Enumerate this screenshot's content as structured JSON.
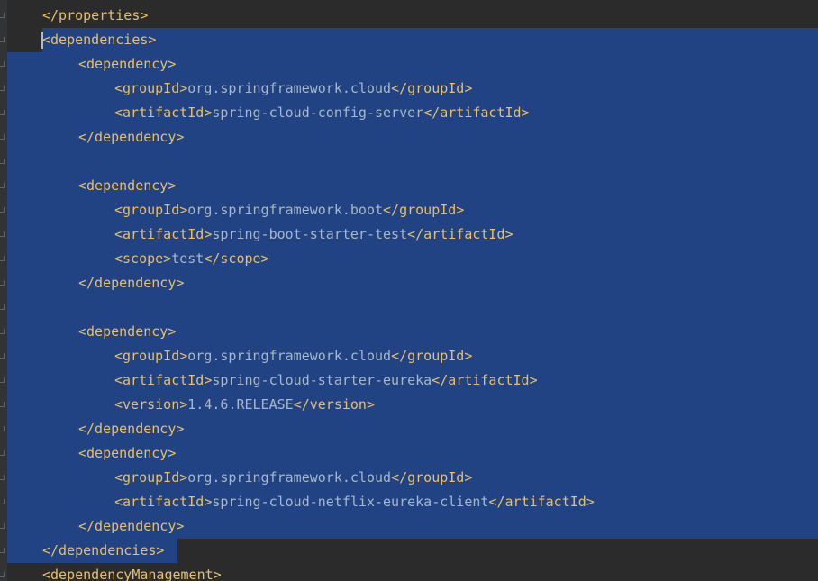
{
  "editor": {
    "language": "xml",
    "colors": {
      "background": "#2b2b2b",
      "gutter": "#313335",
      "selection": "#214283",
      "tag": "#e8bf6a",
      "text": "#a9b7c6"
    },
    "lines": [
      {
        "indent": 1,
        "parts": [
          {
            "t": "tag",
            "v": "</properties>"
          }
        ]
      },
      {
        "indent": 1,
        "parts": [
          {
            "t": "tag",
            "v": "<dependencies>"
          }
        ]
      },
      {
        "indent": 2,
        "parts": [
          {
            "t": "tag",
            "v": "<dependency>"
          }
        ]
      },
      {
        "indent": 3,
        "parts": [
          {
            "t": "tag",
            "v": "<groupId>"
          },
          {
            "t": "txt",
            "v": "org.springframework.cloud"
          },
          {
            "t": "tag",
            "v": "</groupId>"
          }
        ]
      },
      {
        "indent": 3,
        "parts": [
          {
            "t": "tag",
            "v": "<artifactId>"
          },
          {
            "t": "txt",
            "v": "spring-cloud-config-server"
          },
          {
            "t": "tag",
            "v": "</artifactId>"
          }
        ]
      },
      {
        "indent": 2,
        "parts": [
          {
            "t": "tag",
            "v": "</dependency>"
          }
        ]
      },
      {
        "indent": 0,
        "parts": []
      },
      {
        "indent": 2,
        "parts": [
          {
            "t": "tag",
            "v": "<dependency>"
          }
        ]
      },
      {
        "indent": 3,
        "parts": [
          {
            "t": "tag",
            "v": "<groupId>"
          },
          {
            "t": "txt",
            "v": "org.springframework.boot"
          },
          {
            "t": "tag",
            "v": "</groupId>"
          }
        ]
      },
      {
        "indent": 3,
        "parts": [
          {
            "t": "tag",
            "v": "<artifactId>"
          },
          {
            "t": "txt",
            "v": "spring-boot-starter-test"
          },
          {
            "t": "tag",
            "v": "</artifactId>"
          }
        ]
      },
      {
        "indent": 3,
        "parts": [
          {
            "t": "tag",
            "v": "<scope>"
          },
          {
            "t": "txt",
            "v": "test"
          },
          {
            "t": "tag",
            "v": "</scope>"
          }
        ]
      },
      {
        "indent": 2,
        "parts": [
          {
            "t": "tag",
            "v": "</dependency>"
          }
        ]
      },
      {
        "indent": 0,
        "parts": []
      },
      {
        "indent": 2,
        "parts": [
          {
            "t": "tag",
            "v": "<dependency>"
          }
        ]
      },
      {
        "indent": 3,
        "parts": [
          {
            "t": "tag",
            "v": "<groupId>"
          },
          {
            "t": "txt",
            "v": "org.springframework.cloud"
          },
          {
            "t": "tag",
            "v": "</groupId>"
          }
        ]
      },
      {
        "indent": 3,
        "parts": [
          {
            "t": "tag",
            "v": "<artifactId>"
          },
          {
            "t": "txt",
            "v": "spring-cloud-starter-eureka"
          },
          {
            "t": "tag",
            "v": "</artifactId>"
          }
        ]
      },
      {
        "indent": 3,
        "parts": [
          {
            "t": "tag",
            "v": "<version>"
          },
          {
            "t": "txt",
            "v": "1.4.6.RELEASE"
          },
          {
            "t": "tag",
            "v": "</version>"
          }
        ]
      },
      {
        "indent": 2,
        "parts": [
          {
            "t": "tag",
            "v": "</dependency>"
          }
        ]
      },
      {
        "indent": 2,
        "parts": [
          {
            "t": "tag",
            "v": "<dependency>"
          }
        ]
      },
      {
        "indent": 3,
        "parts": [
          {
            "t": "tag",
            "v": "<groupId>"
          },
          {
            "t": "txt",
            "v": "org.springframework.cloud"
          },
          {
            "t": "tag",
            "v": "</groupId>"
          }
        ]
      },
      {
        "indent": 3,
        "parts": [
          {
            "t": "tag",
            "v": "<artifactId>"
          },
          {
            "t": "txt",
            "v": "spring-cloud-netflix-eureka-client"
          },
          {
            "t": "tag",
            "v": "</artifactId>"
          }
        ]
      },
      {
        "indent": 2,
        "parts": [
          {
            "t": "tag",
            "v": "</dependency>"
          }
        ]
      },
      {
        "indent": 1,
        "parts": [
          {
            "t": "tag",
            "v": "</dependencies>"
          }
        ]
      },
      {
        "indent": 1,
        "parts": [
          {
            "t": "tag",
            "v": "<dependencyManagement>"
          }
        ]
      }
    ]
  }
}
